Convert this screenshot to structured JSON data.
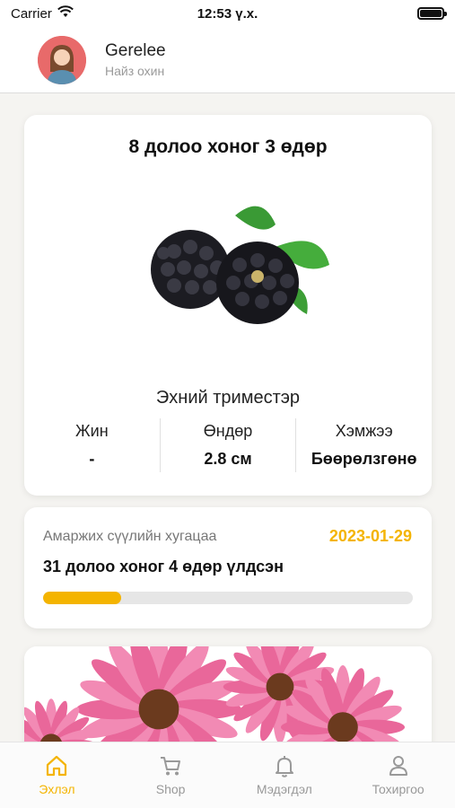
{
  "status_bar": {
    "carrier": "Carrier",
    "time": "12:53 ү.х."
  },
  "header": {
    "user_name": "Gerelee",
    "user_role": "Найз охин"
  },
  "week_card": {
    "title": "8 долоо хоног 3 өдөр",
    "fruit_icon": "blackberry-image",
    "trimester": "Эхний триместэр",
    "stats": [
      {
        "label": "Жин",
        "value": "-"
      },
      {
        "label": "Өндөр",
        "value": "2.8 см"
      },
      {
        "label": "Хэмжээ",
        "value": "Бөөрөлзгөнө"
      }
    ]
  },
  "due_card": {
    "label": "Амаржих сүүлийн хугацаа",
    "date": "2023-01-29",
    "remaining": "31 долоо хоног 4 өдөр үлдсэн",
    "progress_fraction": 0.21
  },
  "flower_card": {
    "image": "pink-daisy-flowers-image"
  },
  "bottom_nav": {
    "items": [
      {
        "label": "Эхлэл",
        "icon": "home-icon",
        "active": true
      },
      {
        "label": "Shop",
        "icon": "cart-icon",
        "active": false
      },
      {
        "label": "Мэдэгдэл",
        "icon": "bell-icon",
        "active": false
      },
      {
        "label": "Тохиргоо",
        "icon": "user-icon",
        "active": false
      }
    ]
  },
  "colors": {
    "accent": "#f4b400",
    "background": "#f5f4f1",
    "avatar_bg": "#e86a6a"
  }
}
